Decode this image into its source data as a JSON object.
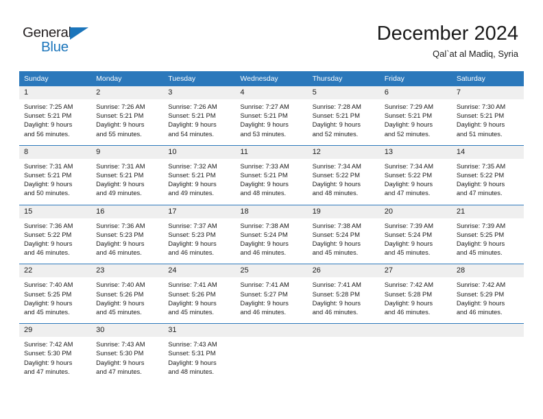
{
  "brand": {
    "name_part1": "General",
    "name_part2": "Blue",
    "accent_color": "#1b75bb"
  },
  "header": {
    "title": "December 2024",
    "subtitle": "Qal`at al Madiq, Syria"
  },
  "calendar": {
    "header_bg": "#2b78bb",
    "daynum_bg": "#efefef",
    "weekday_headers": [
      "Sunday",
      "Monday",
      "Tuesday",
      "Wednesday",
      "Thursday",
      "Friday",
      "Saturday"
    ],
    "weeks": [
      [
        {
          "day": "1",
          "sunrise": "Sunrise: 7:25 AM",
          "sunset": "Sunset: 5:21 PM",
          "daylight_line1": "Daylight: 9 hours",
          "daylight_line2": "and 56 minutes."
        },
        {
          "day": "2",
          "sunrise": "Sunrise: 7:26 AM",
          "sunset": "Sunset: 5:21 PM",
          "daylight_line1": "Daylight: 9 hours",
          "daylight_line2": "and 55 minutes."
        },
        {
          "day": "3",
          "sunrise": "Sunrise: 7:26 AM",
          "sunset": "Sunset: 5:21 PM",
          "daylight_line1": "Daylight: 9 hours",
          "daylight_line2": "and 54 minutes."
        },
        {
          "day": "4",
          "sunrise": "Sunrise: 7:27 AM",
          "sunset": "Sunset: 5:21 PM",
          "daylight_line1": "Daylight: 9 hours",
          "daylight_line2": "and 53 minutes."
        },
        {
          "day": "5",
          "sunrise": "Sunrise: 7:28 AM",
          "sunset": "Sunset: 5:21 PM",
          "daylight_line1": "Daylight: 9 hours",
          "daylight_line2": "and 52 minutes."
        },
        {
          "day": "6",
          "sunrise": "Sunrise: 7:29 AM",
          "sunset": "Sunset: 5:21 PM",
          "daylight_line1": "Daylight: 9 hours",
          "daylight_line2": "and 52 minutes."
        },
        {
          "day": "7",
          "sunrise": "Sunrise: 7:30 AM",
          "sunset": "Sunset: 5:21 PM",
          "daylight_line1": "Daylight: 9 hours",
          "daylight_line2": "and 51 minutes."
        }
      ],
      [
        {
          "day": "8",
          "sunrise": "Sunrise: 7:31 AM",
          "sunset": "Sunset: 5:21 PM",
          "daylight_line1": "Daylight: 9 hours",
          "daylight_line2": "and 50 minutes."
        },
        {
          "day": "9",
          "sunrise": "Sunrise: 7:31 AM",
          "sunset": "Sunset: 5:21 PM",
          "daylight_line1": "Daylight: 9 hours",
          "daylight_line2": "and 49 minutes."
        },
        {
          "day": "10",
          "sunrise": "Sunrise: 7:32 AM",
          "sunset": "Sunset: 5:21 PM",
          "daylight_line1": "Daylight: 9 hours",
          "daylight_line2": "and 49 minutes."
        },
        {
          "day": "11",
          "sunrise": "Sunrise: 7:33 AM",
          "sunset": "Sunset: 5:21 PM",
          "daylight_line1": "Daylight: 9 hours",
          "daylight_line2": "and 48 minutes."
        },
        {
          "day": "12",
          "sunrise": "Sunrise: 7:34 AM",
          "sunset": "Sunset: 5:22 PM",
          "daylight_line1": "Daylight: 9 hours",
          "daylight_line2": "and 48 minutes."
        },
        {
          "day": "13",
          "sunrise": "Sunrise: 7:34 AM",
          "sunset": "Sunset: 5:22 PM",
          "daylight_line1": "Daylight: 9 hours",
          "daylight_line2": "and 47 minutes."
        },
        {
          "day": "14",
          "sunrise": "Sunrise: 7:35 AM",
          "sunset": "Sunset: 5:22 PM",
          "daylight_line1": "Daylight: 9 hours",
          "daylight_line2": "and 47 minutes."
        }
      ],
      [
        {
          "day": "15",
          "sunrise": "Sunrise: 7:36 AM",
          "sunset": "Sunset: 5:22 PM",
          "daylight_line1": "Daylight: 9 hours",
          "daylight_line2": "and 46 minutes."
        },
        {
          "day": "16",
          "sunrise": "Sunrise: 7:36 AM",
          "sunset": "Sunset: 5:23 PM",
          "daylight_line1": "Daylight: 9 hours",
          "daylight_line2": "and 46 minutes."
        },
        {
          "day": "17",
          "sunrise": "Sunrise: 7:37 AM",
          "sunset": "Sunset: 5:23 PM",
          "daylight_line1": "Daylight: 9 hours",
          "daylight_line2": "and 46 minutes."
        },
        {
          "day": "18",
          "sunrise": "Sunrise: 7:38 AM",
          "sunset": "Sunset: 5:24 PM",
          "daylight_line1": "Daylight: 9 hours",
          "daylight_line2": "and 46 minutes."
        },
        {
          "day": "19",
          "sunrise": "Sunrise: 7:38 AM",
          "sunset": "Sunset: 5:24 PM",
          "daylight_line1": "Daylight: 9 hours",
          "daylight_line2": "and 45 minutes."
        },
        {
          "day": "20",
          "sunrise": "Sunrise: 7:39 AM",
          "sunset": "Sunset: 5:24 PM",
          "daylight_line1": "Daylight: 9 hours",
          "daylight_line2": "and 45 minutes."
        },
        {
          "day": "21",
          "sunrise": "Sunrise: 7:39 AM",
          "sunset": "Sunset: 5:25 PM",
          "daylight_line1": "Daylight: 9 hours",
          "daylight_line2": "and 45 minutes."
        }
      ],
      [
        {
          "day": "22",
          "sunrise": "Sunrise: 7:40 AM",
          "sunset": "Sunset: 5:25 PM",
          "daylight_line1": "Daylight: 9 hours",
          "daylight_line2": "and 45 minutes."
        },
        {
          "day": "23",
          "sunrise": "Sunrise: 7:40 AM",
          "sunset": "Sunset: 5:26 PM",
          "daylight_line1": "Daylight: 9 hours",
          "daylight_line2": "and 45 minutes."
        },
        {
          "day": "24",
          "sunrise": "Sunrise: 7:41 AM",
          "sunset": "Sunset: 5:26 PM",
          "daylight_line1": "Daylight: 9 hours",
          "daylight_line2": "and 45 minutes."
        },
        {
          "day": "25",
          "sunrise": "Sunrise: 7:41 AM",
          "sunset": "Sunset: 5:27 PM",
          "daylight_line1": "Daylight: 9 hours",
          "daylight_line2": "and 46 minutes."
        },
        {
          "day": "26",
          "sunrise": "Sunrise: 7:41 AM",
          "sunset": "Sunset: 5:28 PM",
          "daylight_line1": "Daylight: 9 hours",
          "daylight_line2": "and 46 minutes."
        },
        {
          "day": "27",
          "sunrise": "Sunrise: 7:42 AM",
          "sunset": "Sunset: 5:28 PM",
          "daylight_line1": "Daylight: 9 hours",
          "daylight_line2": "and 46 minutes."
        },
        {
          "day": "28",
          "sunrise": "Sunrise: 7:42 AM",
          "sunset": "Sunset: 5:29 PM",
          "daylight_line1": "Daylight: 9 hours",
          "daylight_line2": "and 46 minutes."
        }
      ],
      [
        {
          "day": "29",
          "sunrise": "Sunrise: 7:42 AM",
          "sunset": "Sunset: 5:30 PM",
          "daylight_line1": "Daylight: 9 hours",
          "daylight_line2": "and 47 minutes."
        },
        {
          "day": "30",
          "sunrise": "Sunrise: 7:43 AM",
          "sunset": "Sunset: 5:30 PM",
          "daylight_line1": "Daylight: 9 hours",
          "daylight_line2": "and 47 minutes."
        },
        {
          "day": "31",
          "sunrise": "Sunrise: 7:43 AM",
          "sunset": "Sunset: 5:31 PM",
          "daylight_line1": "Daylight: 9 hours",
          "daylight_line2": "and 48 minutes."
        },
        {
          "day": "",
          "sunrise": "",
          "sunset": "",
          "daylight_line1": "",
          "daylight_line2": ""
        },
        {
          "day": "",
          "sunrise": "",
          "sunset": "",
          "daylight_line1": "",
          "daylight_line2": ""
        },
        {
          "day": "",
          "sunrise": "",
          "sunset": "",
          "daylight_line1": "",
          "daylight_line2": ""
        },
        {
          "day": "",
          "sunrise": "",
          "sunset": "",
          "daylight_line1": "",
          "daylight_line2": ""
        }
      ]
    ]
  }
}
